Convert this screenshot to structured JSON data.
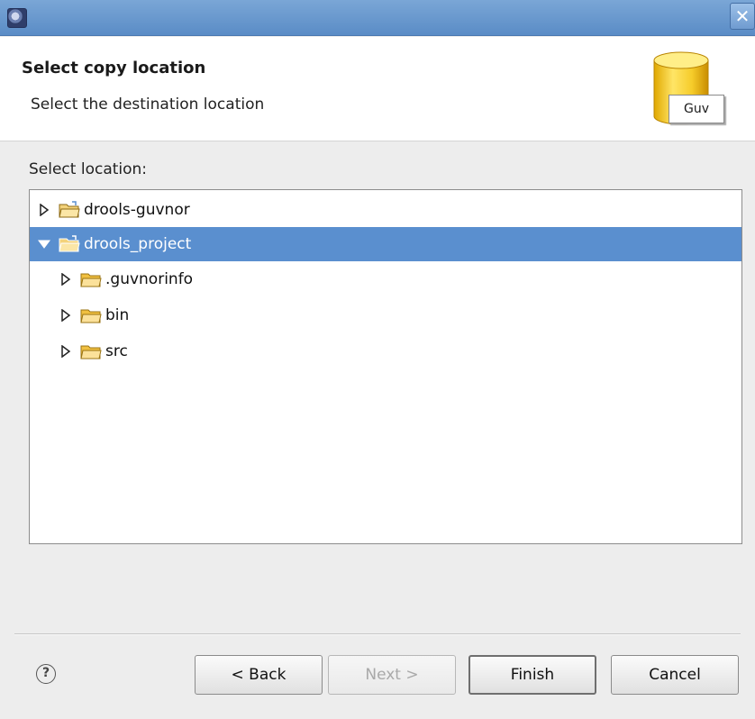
{
  "window": {
    "title": "",
    "app_icon": "eclipse-icon",
    "close_glyph": "✕"
  },
  "header": {
    "title": "Select copy location",
    "subtitle": "Select the destination location",
    "banner_icon": "guvnor-repository-icon",
    "banner_label": "Guv"
  },
  "location": {
    "label": "Select location:",
    "tree": [
      {
        "label": "drools-guvnor",
        "expanded": false,
        "selected": false,
        "depth": 0,
        "icon": "project-folder-icon"
      },
      {
        "label": "drools_project",
        "expanded": true,
        "selected": true,
        "depth": 0,
        "icon": "project-folder-icon"
      },
      {
        "label": ".guvnorinfo",
        "expanded": false,
        "selected": false,
        "depth": 1,
        "icon": "folder-icon"
      },
      {
        "label": "bin",
        "expanded": false,
        "selected": false,
        "depth": 1,
        "icon": "folder-icon"
      },
      {
        "label": "src",
        "expanded": false,
        "selected": false,
        "depth": 1,
        "icon": "folder-icon"
      }
    ]
  },
  "footer": {
    "help_glyph": "?",
    "back_label": "< Back",
    "next_label": "Next >",
    "finish_label": "Finish",
    "cancel_label": "Cancel",
    "next_enabled": false
  },
  "colors": {
    "titlebar": "#5a8cc6",
    "selection": "#5a8fcf",
    "folder": "#f0c040"
  }
}
